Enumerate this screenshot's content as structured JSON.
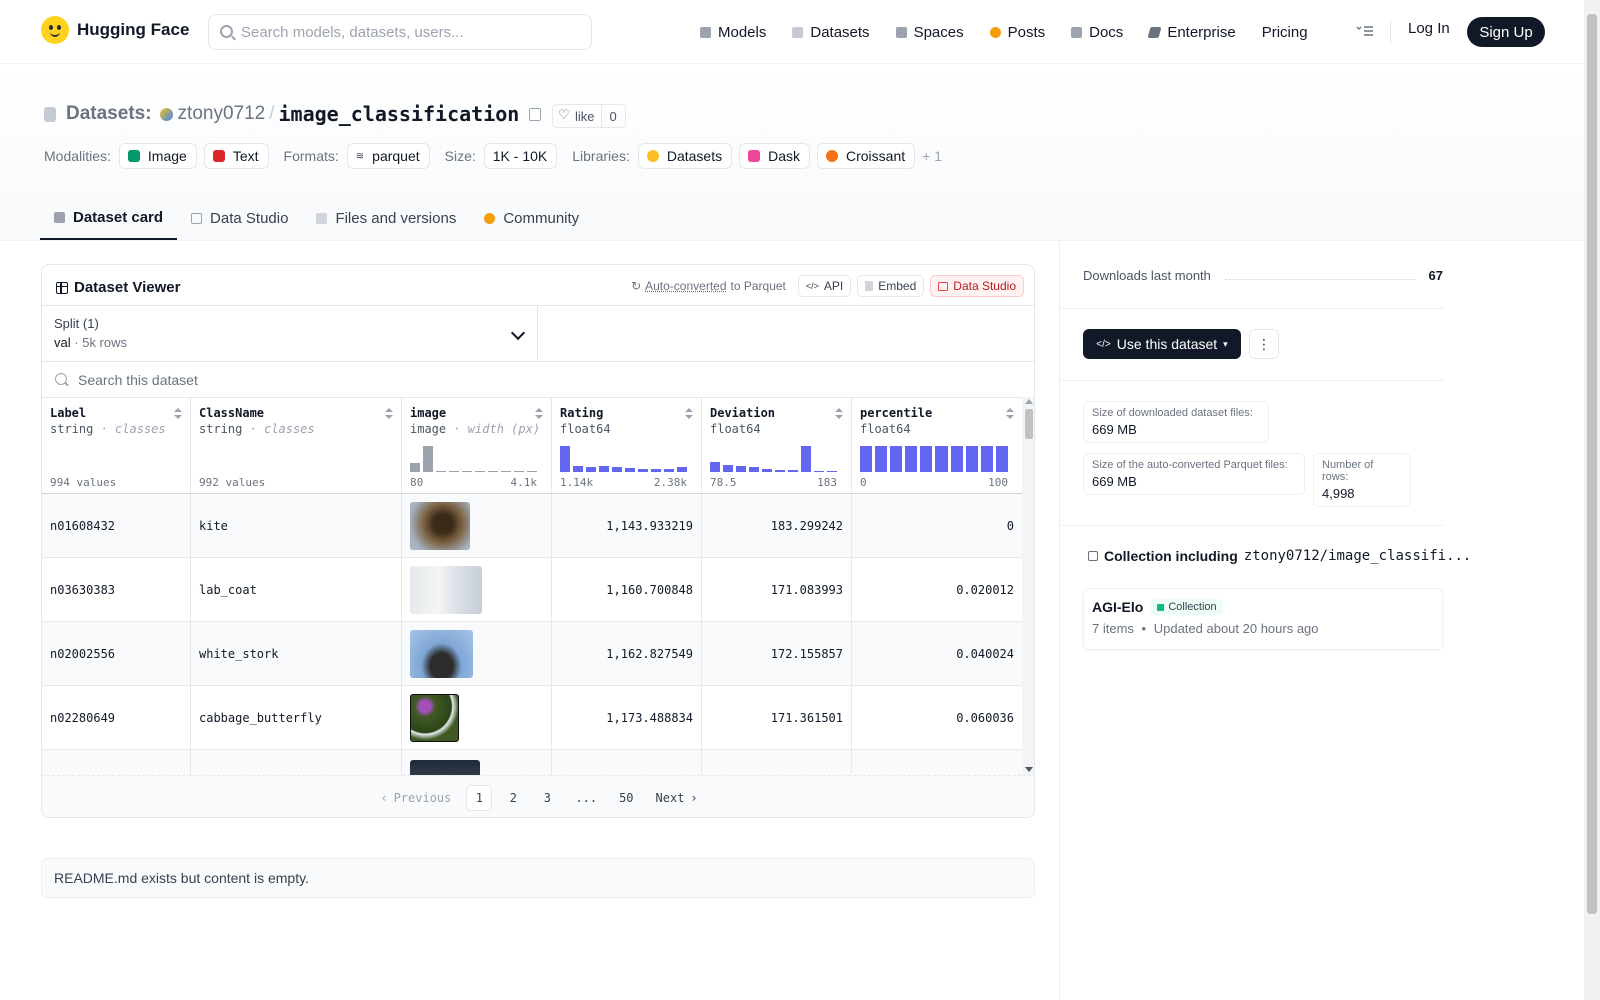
{
  "nav": {
    "brand": "Hugging Face",
    "search_placeholder": "Search models, datasets, users...",
    "items": [
      {
        "label": "Models",
        "icon": "cube-icon",
        "color": "#9ca3af"
      },
      {
        "label": "Datasets",
        "icon": "database-icon",
        "color": "#c5cad3"
      },
      {
        "label": "Spaces",
        "icon": "grid-icon",
        "color": "#9ca3af"
      },
      {
        "label": "Posts",
        "icon": "speech-bubble-icon",
        "color": "#f59e0b"
      },
      {
        "label": "Docs",
        "icon": "book-icon",
        "color": "#9ca3af"
      },
      {
        "label": "Enterprise",
        "icon": "enterprise-icon",
        "color": "#6b7280"
      },
      {
        "label": "Pricing",
        "icon": "",
        "color": ""
      }
    ],
    "login": "Log In",
    "signup": "Sign Up"
  },
  "header": {
    "section": "Datasets:",
    "owner": "ztony0712",
    "separator": "/",
    "dataset": "image_classification",
    "like_label": "like",
    "like_count": "0",
    "modalities_label": "Modalities:",
    "modalities": [
      {
        "label": "Image",
        "color": "#059669"
      },
      {
        "label": "Text",
        "color": "#dc2626"
      }
    ],
    "formats_label": "Formats:",
    "format": "parquet",
    "size_label": "Size:",
    "size": "1K - 10K",
    "libraries_label": "Libraries:",
    "libraries": [
      {
        "label": "Datasets",
        "color": "#fbbf24"
      },
      {
        "label": "Dask",
        "color": "#ec4899"
      },
      {
        "label": "Croissant",
        "color": "#f97316"
      }
    ],
    "more_libraries": "+ 1"
  },
  "tabs": [
    {
      "label": "Dataset card",
      "icon": "cube-icon",
      "color": "#9ca3af"
    },
    {
      "label": "Data Studio",
      "icon": "table-icon",
      "color": "#9ca3af"
    },
    {
      "label": "Files and versions",
      "icon": "files-icon",
      "color": "#9ca3af"
    },
    {
      "label": "Community",
      "icon": "community-icon",
      "color": "#f59e0b"
    }
  ],
  "viewer": {
    "title": "Dataset Viewer",
    "auto_converted": "Auto-converted",
    "to_parquet": "to Parquet",
    "api": "API",
    "embed": "Embed",
    "data_studio": "Data Studio",
    "split_title": "Split (1)",
    "split_value": "val",
    "split_dot": "·",
    "split_rows": "5k rows",
    "search_placeholder": "Search this dataset",
    "columns": [
      {
        "name": "Label",
        "type": "string",
        "type_note": "· classes",
        "footer": "994 values"
      },
      {
        "name": "ClassName",
        "type": "string",
        "type_note": "· classes",
        "footer": "992 values"
      },
      {
        "name": "image",
        "type": "image",
        "type_note": "· width (px)",
        "min": "80",
        "max": "4.1k"
      },
      {
        "name": "Rating",
        "type": "float64",
        "type_note": "",
        "min": "1.14k",
        "max": "2.38k"
      },
      {
        "name": "Deviation",
        "type": "float64",
        "type_note": "",
        "min": "78.5",
        "max": "183"
      },
      {
        "name": "percentile",
        "type": "float64",
        "type_note": "",
        "min": "0",
        "max": "100"
      }
    ],
    "histograms": {
      "image": [
        0.35,
        1.0,
        0.04,
        0.04,
        0.04,
        0.04,
        0.04,
        0.04,
        0.04,
        0.04
      ],
      "Rating": [
        1.0,
        0.25,
        0.18,
        0.22,
        0.18,
        0.15,
        0.13,
        0.11,
        0.11,
        0.18
      ],
      "Deviation": [
        0.4,
        0.28,
        0.22,
        0.18,
        0.13,
        0.09,
        0.06,
        1.0,
        0.04,
        0.04
      ],
      "percentile": [
        1,
        1,
        1,
        1,
        1,
        1,
        1,
        1,
        1,
        1
      ]
    },
    "rows": [
      {
        "label": "n01608432",
        "classname": "kite",
        "image_alt": "kite bird photo",
        "rating": "1,143.933219",
        "deviation": "183.299242",
        "percentile": "0",
        "thumb": "#6b5234"
      },
      {
        "label": "n03630383",
        "classname": "lab_coat",
        "image_alt": "lab coat photo",
        "rating": "1,160.700848",
        "deviation": "171.083993",
        "percentile": "0.020012",
        "thumb": "#cfd6dd"
      },
      {
        "label": "n02002556",
        "classname": "white_stork",
        "image_alt": "white stork photo",
        "rating": "1,162.827549",
        "deviation": "172.155857",
        "percentile": "0.040024",
        "thumb": "#7fa6d6"
      },
      {
        "label": "n02280649",
        "classname": "cabbage_butterfly",
        "image_alt": "cabbage butterfly photo",
        "rating": "1,173.488834",
        "deviation": "171.361501",
        "percentile": "0.060036",
        "thumb": "#3f5a24"
      }
    ],
    "pager": {
      "prev": "Previous",
      "pages": [
        "1",
        "2",
        "3",
        "...",
        "50"
      ],
      "next": "Next"
    }
  },
  "readme": "README.md exists but content is empty.",
  "sidebar": {
    "downloads_label": "Downloads last month",
    "downloads_value": "67",
    "use_button": "Use this dataset",
    "stats": [
      {
        "label": "Size of downloaded dataset files:",
        "value": "669 MB"
      },
      {
        "label": "Size of the auto-converted Parquet files:",
        "value": "669 MB"
      },
      {
        "label": "Number of rows:",
        "value": "4,998"
      }
    ],
    "collection_title": "Collection including",
    "collection_repo": "ztony0712/image_classifi...",
    "collection_name": "AGI-Elo",
    "collection_badge": "Collection",
    "collection_items": "7 items",
    "collection_sep": "•",
    "collection_updated": "Updated about 20 hours ago"
  }
}
